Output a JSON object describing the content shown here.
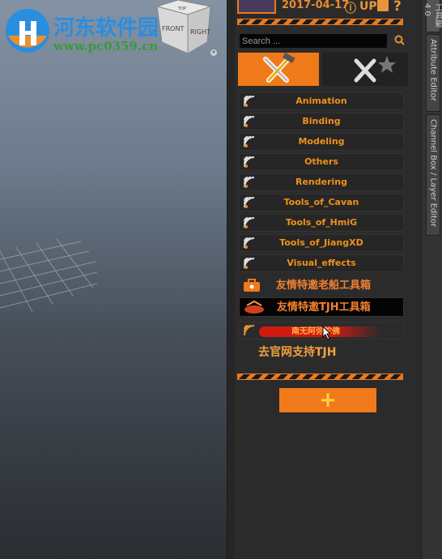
{
  "viewport": {
    "watermark_cn": "河东软件园",
    "watermark_url": "www.pc0359.cn",
    "cube_faces": [
      "FRONT",
      "RIGHT",
      "TOP"
    ]
  },
  "header": {
    "date": "2017-04-17",
    "icons": [
      "help-head-icon",
      "update-icon",
      "save-icon",
      "question-icon"
    ],
    "update_label": "UP",
    "question_label": "?"
  },
  "search": {
    "placeholder": "Search ..."
  },
  "tabs": [
    {
      "name": "tools",
      "active": true
    },
    {
      "name": "favorites",
      "active": false
    }
  ],
  "categories": [
    "Animation",
    "Binding",
    "Modeling",
    "Others",
    "Rendering",
    "Tools_of_Cavan",
    "Tools_of_HmiG",
    "Tools_of_JiangXD",
    "Visual_effects"
  ],
  "extras": [
    {
      "label": "友情特邀老船工具箱",
      "icon": "toolbox-icon"
    },
    {
      "label": "友情特邀TJH工具箱",
      "icon": "tjh-logo-icon",
      "highlighted": true
    }
  ],
  "banner": "南无阿弥陀佛",
  "support_link": "去官网支持TJH",
  "add_button": "+",
  "right_tabs": [
    "工具箱4.0",
    "Attribute Editor",
    "Channel Box / Layer Editor"
  ],
  "colors": {
    "accent": "#f07a1a",
    "text_accent": "#f0901a",
    "panel": "#2b2b2b"
  }
}
